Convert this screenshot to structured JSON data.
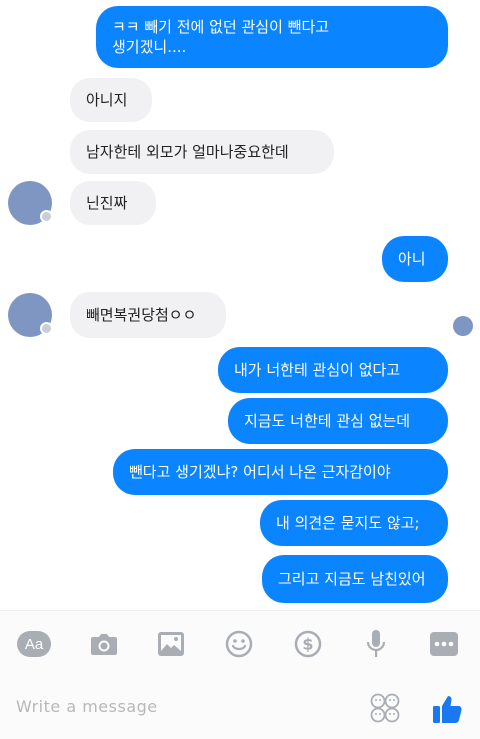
{
  "messages": [
    {
      "side": "out",
      "text": "ㅋㅋ 빼기 전에 없던 관심이 뺀다고\n생기겠니...."
    },
    {
      "side": "in",
      "text": "아니지"
    },
    {
      "side": "in",
      "text": "남자한테 외모가 얼마나중요한데"
    },
    {
      "side": "in",
      "text": "닌진짜"
    },
    {
      "side": "out",
      "text": "아니"
    },
    {
      "side": "in",
      "text": "빼면복권당첨ㅇㅇ"
    },
    {
      "side": "out",
      "text": "내가 너한테 관심이 없다고"
    },
    {
      "side": "out",
      "text": "지금도 너한테 관심 없는데"
    },
    {
      "side": "out",
      "text": "뺀다고 생기겠냐? 어디서 나온 근자감이야"
    },
    {
      "side": "out",
      "text": "내 의견은 묻지도 않고;"
    },
    {
      "side": "out",
      "text": "그리고 지금도 남친있어"
    }
  ],
  "composer": {
    "placeholder": "Write a message",
    "tools": [
      "aa-icon",
      "camera-icon",
      "image-icon",
      "emoji-icon",
      "payment-icon",
      "microphone-icon",
      "more-icon"
    ],
    "aa_label": "Aa",
    "like": "thumbs-up-icon"
  },
  "colors": {
    "outgoing": "#0a84ff",
    "incoming": "#f1f1f3",
    "icon": "#a9aeb5",
    "like": "#1a78f0",
    "avatar": "#7f96c3"
  }
}
